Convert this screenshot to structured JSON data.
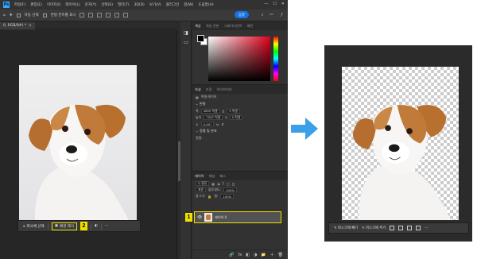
{
  "menubar": {
    "app_logo": "Ps",
    "items": [
      "파일(F)",
      "편집(E)",
      "이미지(I)",
      "레이어(L)",
      "문자(Y)",
      "선택(S)",
      "필터(T)",
      "3D(D)",
      "보기(V)",
      "플러그인",
      "창(W)",
      "도움말(H)"
    ],
    "window_controls": [
      "—",
      "☐",
      "✕"
    ]
  },
  "options_bar": {
    "auto_select_label": "자동 선택",
    "show_transform_label": "변형 컨트롤 표시",
    "share_label": "공유"
  },
  "document_tab": {
    "title": "0, RGB/8#) *",
    "close": "×"
  },
  "color_panel": {
    "tabs": [
      "색상",
      "색상 견본",
      "그레이디언트",
      "패턴"
    ],
    "accent_color": "#e0001b"
  },
  "properties_panel": {
    "tabs": [
      "속성",
      "조정",
      "라이브러리"
    ],
    "layer_type": "픽셀 레이어",
    "transform_header": "변형",
    "width_label": "폭",
    "width_value": "4800 픽셀",
    "height_label": "높이",
    "height_value": "7067 픽셀",
    "x_label": "X",
    "x_value": "0 픽셀",
    "y_label": "Y",
    "y_value": "0 픽셀",
    "angle_value": "0.00°",
    "align_header": "정렬 및 분포",
    "align_label": "정렬:"
  },
  "layers_panel": {
    "tabs": [
      "레이어",
      "채널",
      "패스"
    ],
    "filter_label": "Q 종류",
    "blend_mode": "표준",
    "opacity_label": "불투명도:",
    "opacity_value": "100%",
    "lock_label": "잠그기:",
    "fill_label": "칠:",
    "fill_value": "100%",
    "layer_name": "레이어 0",
    "bottom_icons": [
      "🔗",
      "fx",
      "◧",
      "◑",
      "📁",
      "＋",
      "🗑"
    ]
  },
  "contextual_bar": {
    "select_subject": "피사체 선택",
    "remove_background": "배경 제거",
    "more": "···"
  },
  "contextual_bar_after": {
    "invert_mask": "마스크에 빼기",
    "add_mask": "마스크에 추가",
    "more": "···"
  },
  "callouts": {
    "one": "1",
    "two": "2"
  },
  "accent": {
    "highlight": "#f0e000",
    "arrow": "#3ba0e8"
  }
}
